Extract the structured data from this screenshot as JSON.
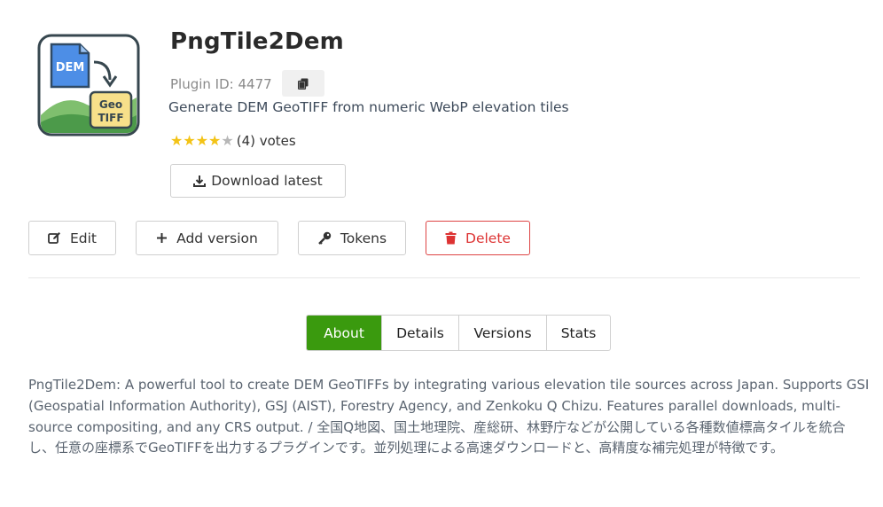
{
  "plugin": {
    "name": "PngTile2Dem",
    "id_text": "Plugin ID: 4477",
    "subtitle": "Generate DEM GeoTIFF from numeric WebP elevation tiles",
    "rating": 4,
    "rating_max": 5,
    "votes_text": "(4) votes"
  },
  "logo": {
    "dem_label": "DEM",
    "geo_label": "Geo",
    "tiff_label": "TIFF"
  },
  "buttons": {
    "download": "Download latest",
    "edit": "Edit",
    "add_version": "Add version",
    "tokens": "Tokens",
    "delete": "Delete"
  },
  "tabs": [
    {
      "label": "About",
      "active": true
    },
    {
      "label": "Details",
      "active": false
    },
    {
      "label": "Versions",
      "active": false
    },
    {
      "label": "Stats",
      "active": false
    }
  ],
  "about": {
    "description": "PngTile2Dem: A powerful tool to create DEM GeoTIFFs by integrating various elevation tile sources across Japan. Supports GSI (Geospatial Information Authority), GSJ (AIST), Forestry Agency, and Zenkoku Q Chizu. Features parallel downloads, multi-source compositing, and any CRS output. / 全国Q地図、国土地理院、産総研、林野庁などが公開している各種数値標高タイルを統合し、任意の座標系でGeoTIFFを出力するプラグインです。並列処理による高速ダウンロードと、高精度な補完処理が特徴です。"
  },
  "colors": {
    "active_tab": "#3a9a0e",
    "delete": "#dd3333",
    "star": "#f3c316"
  }
}
